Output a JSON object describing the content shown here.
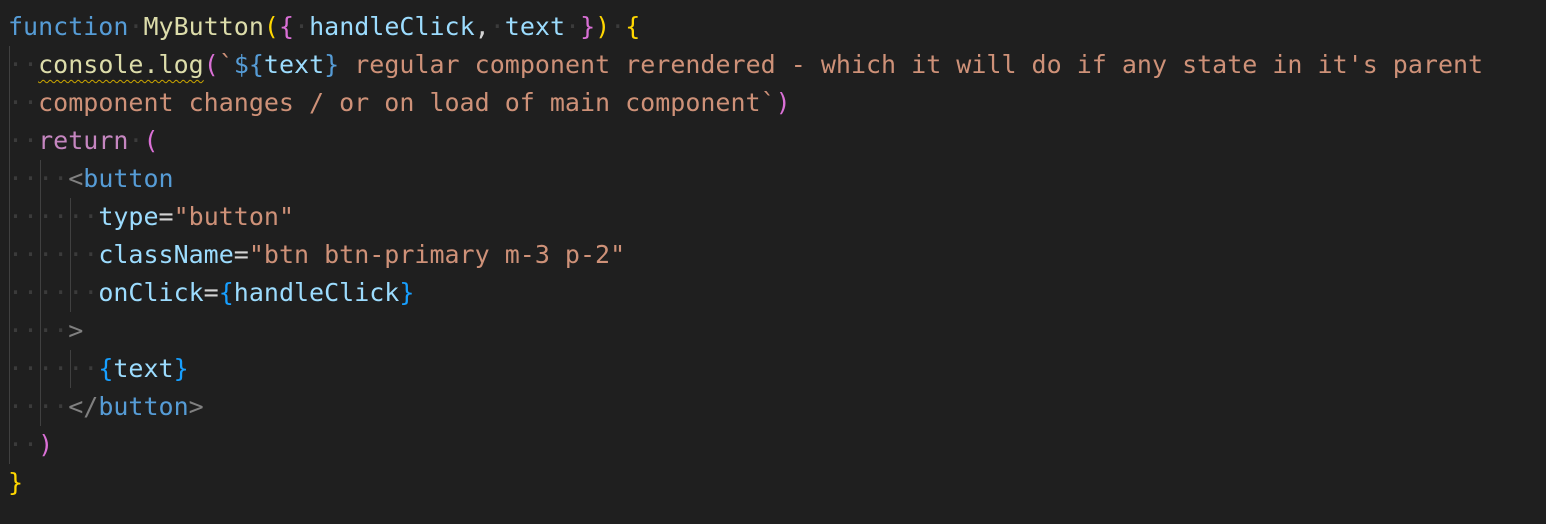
{
  "editor": {
    "lines": [
      {
        "indent": 0,
        "tokens": [
          {
            "t": "function",
            "c": "c-kw"
          },
          {
            "t": " ",
            "c": "dot"
          },
          {
            "t": "MyButton",
            "c": "c-fn"
          },
          {
            "t": "(",
            "c": "c-br1"
          },
          {
            "t": "{",
            "c": "c-br2"
          },
          {
            "t": " ",
            "c": "dot"
          },
          {
            "t": "handleClick",
            "c": "c-var"
          },
          {
            "t": ",",
            "c": "c-plain"
          },
          {
            "t": " ",
            "c": "dot"
          },
          {
            "t": "text",
            "c": "c-var"
          },
          {
            "t": " ",
            "c": "dot"
          },
          {
            "t": "}",
            "c": "c-br2"
          },
          {
            "t": ")",
            "c": "c-br1"
          },
          {
            "t": " ",
            "c": "dot"
          },
          {
            "t": "{",
            "c": "c-br1"
          }
        ]
      },
      {
        "indent": 1,
        "tokens": [
          {
            "t": "console.log",
            "c": "c-fn squiggle"
          },
          {
            "t": "(",
            "c": "c-br2"
          },
          {
            "t": "`",
            "c": "c-str"
          },
          {
            "t": "${",
            "c": "c-tpl"
          },
          {
            "t": "text",
            "c": "c-var"
          },
          {
            "t": "}",
            "c": "c-tpl"
          },
          {
            "t": " regular component rerendered - which it will do if any state in it's parent",
            "c": "c-str"
          }
        ]
      },
      {
        "indent": 1,
        "tokens": [
          {
            "t": "component changes / or on load of main component`",
            "c": "c-str"
          },
          {
            "t": ")",
            "c": "c-br2"
          }
        ]
      },
      {
        "indent": 1,
        "tokens": [
          {
            "t": "return",
            "c": "c-ctl"
          },
          {
            "t": " ",
            "c": "dot"
          },
          {
            "t": "(",
            "c": "c-br2"
          }
        ]
      },
      {
        "indent": 2,
        "tokens": [
          {
            "t": "<",
            "c": "c-tagb"
          },
          {
            "t": "button",
            "c": "c-tag"
          }
        ]
      },
      {
        "indent": 3,
        "tokens": [
          {
            "t": "type",
            "c": "c-attr"
          },
          {
            "t": "=",
            "c": "c-op"
          },
          {
            "t": "\"button\"",
            "c": "c-str"
          }
        ]
      },
      {
        "indent": 3,
        "tokens": [
          {
            "t": "className",
            "c": "c-attr"
          },
          {
            "t": "=",
            "c": "c-op"
          },
          {
            "t": "\"btn btn-primary m-3 p-2\"",
            "c": "c-str"
          }
        ]
      },
      {
        "indent": 3,
        "tokens": [
          {
            "t": "onClick",
            "c": "c-attr"
          },
          {
            "t": "=",
            "c": "c-op"
          },
          {
            "t": "{",
            "c": "c-br3"
          },
          {
            "t": "handleClick",
            "c": "c-var"
          },
          {
            "t": "}",
            "c": "c-br3"
          }
        ]
      },
      {
        "indent": 2,
        "tokens": [
          {
            "t": ">",
            "c": "c-tagb"
          }
        ]
      },
      {
        "indent": 3,
        "tokens": [
          {
            "t": "{",
            "c": "c-br3"
          },
          {
            "t": "text",
            "c": "c-var"
          },
          {
            "t": "}",
            "c": "c-br3"
          }
        ]
      },
      {
        "indent": 2,
        "tokens": [
          {
            "t": "</",
            "c": "c-tagb"
          },
          {
            "t": "button",
            "c": "c-tag"
          },
          {
            "t": ">",
            "c": "c-tagb"
          }
        ]
      },
      {
        "indent": 1,
        "tokens": [
          {
            "t": ")",
            "c": "c-br2"
          }
        ]
      },
      {
        "indent": 0,
        "tokens": [
          {
            "t": "}",
            "c": "c-br1"
          }
        ]
      }
    ]
  }
}
